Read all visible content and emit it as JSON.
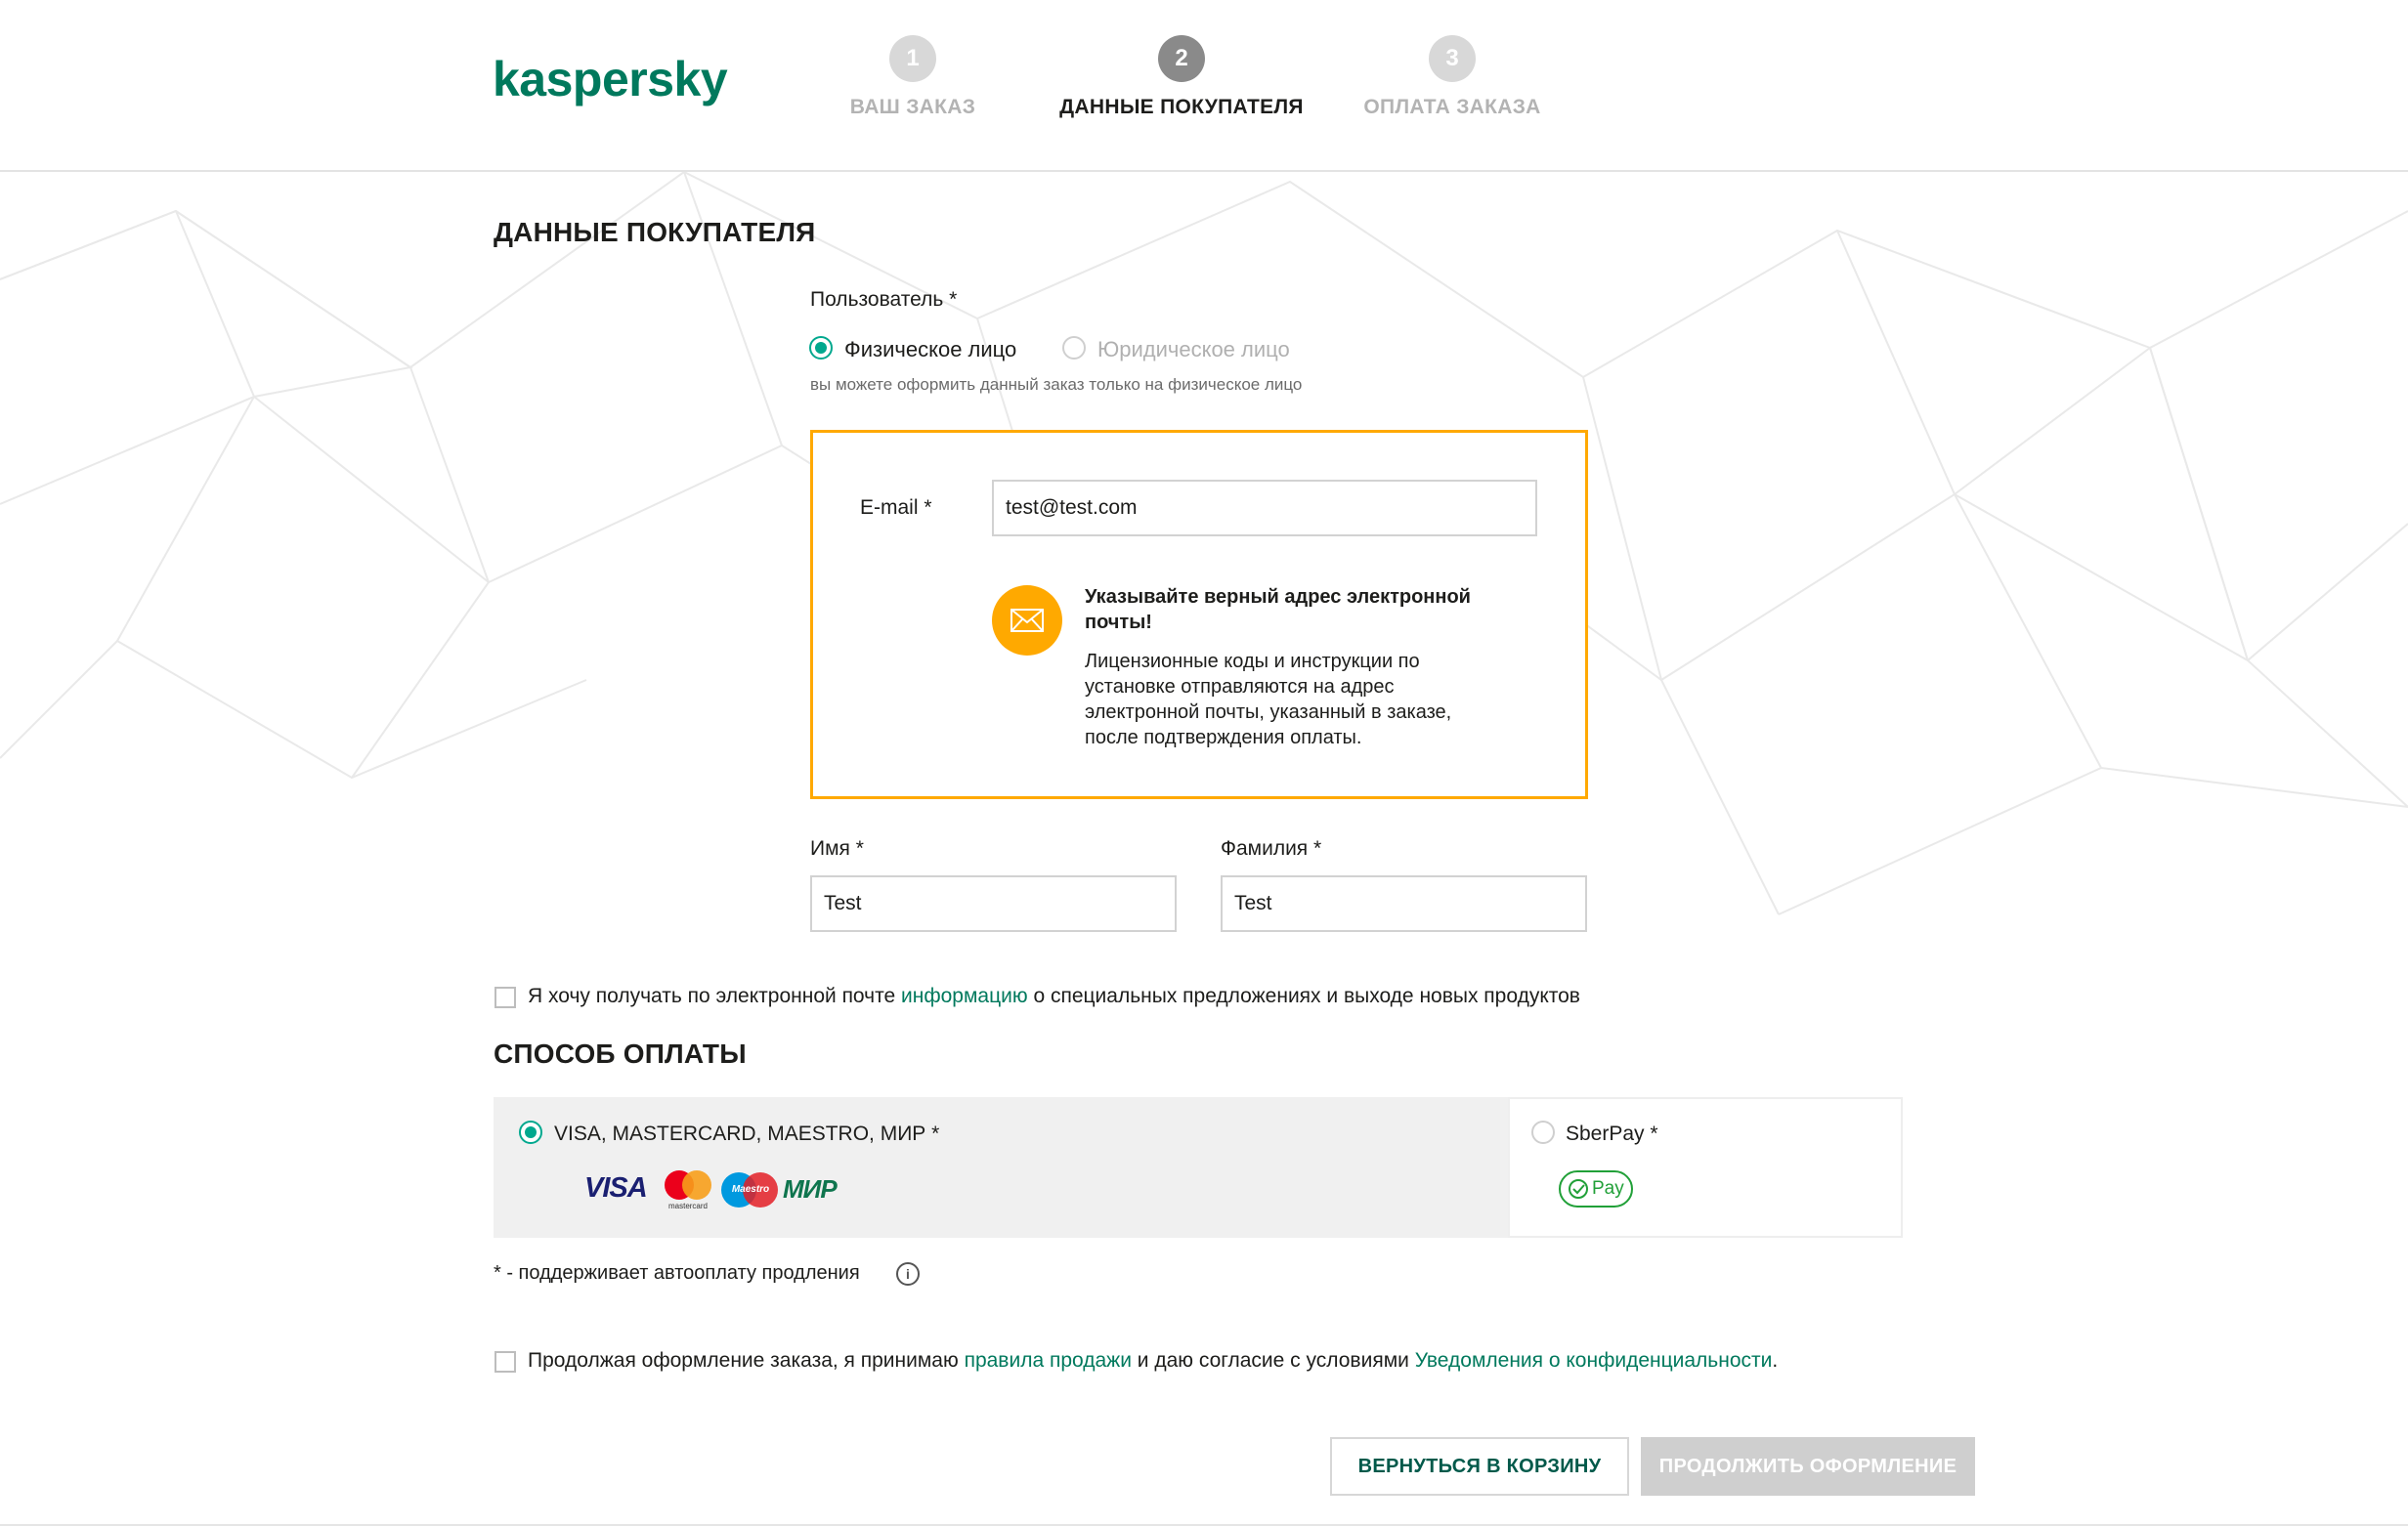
{
  "brand": {
    "logo_text": "kaspersky",
    "color": "#00795d"
  },
  "steps": [
    {
      "number": "1",
      "label": "ВАШ ЗАКАЗ",
      "active": false
    },
    {
      "number": "2",
      "label": "ДАННЫЕ ПОКУПАТЕЛЯ",
      "active": true
    },
    {
      "number": "3",
      "label": "ОПЛАТА ЗАКАЗА",
      "active": false
    }
  ],
  "buyer": {
    "title": "ДАННЫЕ ПОКУПАТЕЛЯ",
    "user_label": "Пользователь *",
    "option_individual": "Физическое лицо",
    "option_company": "Юридическое лицо",
    "user_hint": "вы можете оформить данный заказ только на физическое лицо",
    "email_label": "E-mail *",
    "email_value": "test@test.com",
    "notice_title": "Указывайте верный адрес электронной почты!",
    "notice_text": "Лицензионные коды и инструкции по установке отправляются на адрес электронной почты, указанный в заказе, после подтверждения оплаты.",
    "first_name_label": "Имя *",
    "first_name_value": "Test",
    "last_name_label": "Фамилия *",
    "last_name_value": "Test"
  },
  "newsletter": {
    "before": "Я хочу получать по электронной почте",
    "link": "информацию",
    "after": "о специальных предложениях и выходе новых продуктов"
  },
  "payment": {
    "title": "СПОСОБ ОПЛАТЫ",
    "card_option": "VISA, MASTERCARD, MAESTRO, МИР *",
    "card_logos": {
      "visa": "VISA",
      "mastercard": "mastercard",
      "maestro": "Maestro",
      "mir": "МИР"
    },
    "sberpay_option": "SberPay *",
    "sberpay_logo": "Pay",
    "autopay_note": "* - поддерживает автооплату продления"
  },
  "agreement": {
    "before": "Продолжая оформление заказа, я принимаю",
    "link1": "правила продажи",
    "middle": "и даю согласие с условиями",
    "link2": "Уведомления о конфиденциальности",
    "after": "."
  },
  "buttons": {
    "back": "ВЕРНУТЬСЯ В КОРЗИНУ",
    "continue": "ПРОДОЛЖИТЬ ОФОРМЛЕНИЕ"
  },
  "colors": {
    "accent_green": "#00a88e",
    "warning_orange": "#ffa900",
    "link_green": "#00795d"
  }
}
